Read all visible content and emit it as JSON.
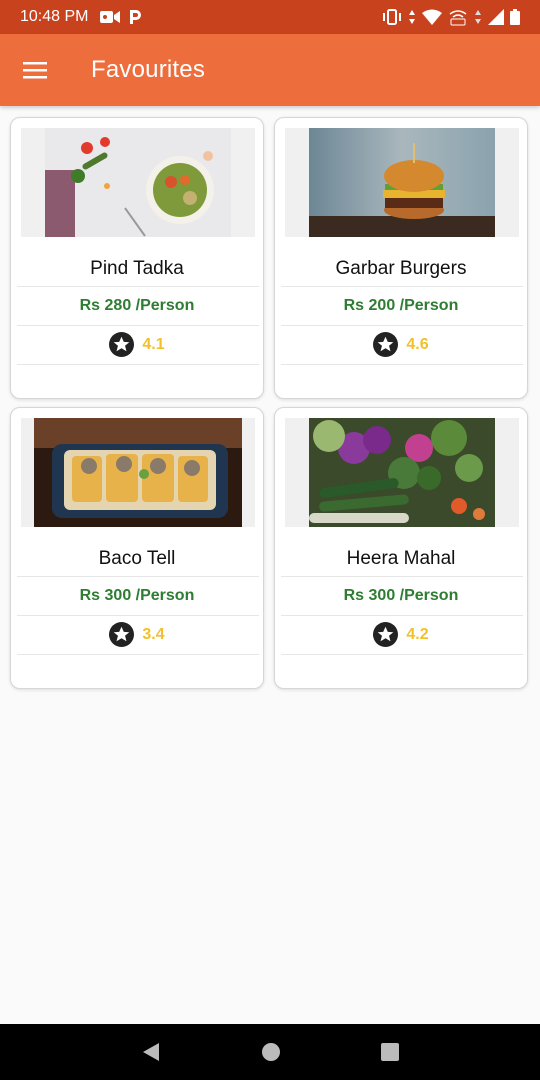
{
  "status_bar": {
    "time": "10:48 PM"
  },
  "app_bar": {
    "title": "Favourites"
  },
  "restaurants": [
    {
      "name": "Pind Tadka",
      "price": "Rs 280 /Person",
      "rating": "4.1"
    },
    {
      "name": "Garbar Burgers",
      "price": "Rs 200 /Person",
      "rating": "4.6"
    },
    {
      "name": "Baco Tell",
      "price": "Rs 300 /Person",
      "rating": "3.4"
    },
    {
      "name": "Heera Mahal",
      "price": "Rs 300 /Person",
      "rating": "4.2"
    }
  ],
  "colors": {
    "status_bar": "#c7421d",
    "app_bar": "#ee6d3d",
    "price": "#2e7d32",
    "rating": "#f2c02a"
  },
  "icons": [
    "menu-icon",
    "star-icon",
    "back-icon",
    "home-icon",
    "recents-icon"
  ]
}
